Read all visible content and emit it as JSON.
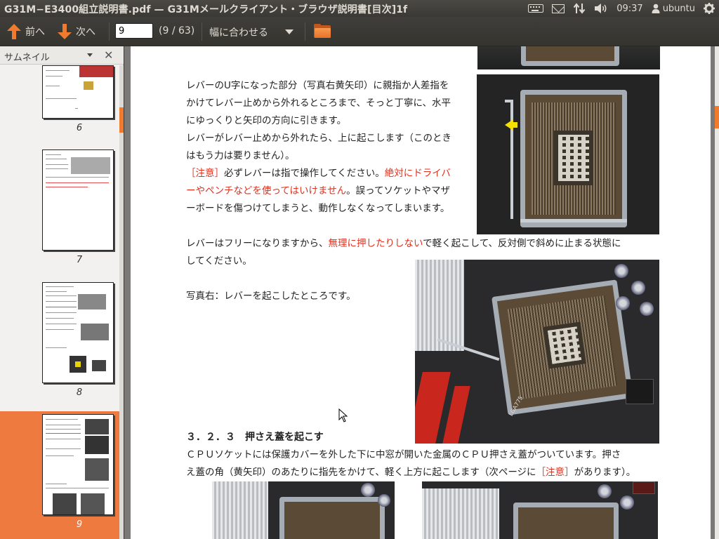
{
  "window": {
    "title": "G31M−E3400組立説明書.pdf — G31Mメールクライアント・ブラウザ説明書[目次]1f"
  },
  "panel": {
    "indicators": [
      "keyboard-icon",
      "mail-icon",
      "network-icon",
      "volume-icon"
    ],
    "clock": "09:37",
    "user": "ubuntu"
  },
  "toolbar": {
    "prev_label": "前へ",
    "next_label": "次へ",
    "page_value": "9",
    "page_count": "(9 / 63)",
    "zoom_label": "幅に合わせる"
  },
  "sidebar": {
    "title": "サムネイル",
    "thumbnails": [
      {
        "page": "6"
      },
      {
        "page": "7"
      },
      {
        "page": "8"
      },
      {
        "page": "9",
        "selected": true
      }
    ]
  },
  "document": {
    "para1": [
      "レバーのU字になった部分（写真右黄矢印）に親指か人差指を",
      "かけてレバー止めから外れるところまで、そっと丁寧に、水平",
      "にゆっくりと矢印の方向に引きます。",
      "レバーがレバー止めから外れたら、上に起こします（このとき",
      "はもう力は要りません）。"
    ],
    "caution1": {
      "tag": "［注意］",
      "plain1": "必ずレバーは指で操作してください。",
      "red1": "絶対にドライバ",
      "red2": "ーやペンチなどを使ってはいけません",
      "plain2": "。誤ってソケットやマザ",
      "line3": "ーボードを傷つけてしまうと、動作しなくなってしまいます。"
    },
    "para2": {
      "plain1": "レバーはフリーになりますから、",
      "red": "無理に押したりしない",
      "plain2": "で軽く起こして、反対側で斜めに止まる状態に",
      "line2": "してください。"
    },
    "caption": "写真右：レバーを起こしたところです。",
    "section_heading": "３．２．３　押さえ蓋を起こす",
    "para3": {
      "line1": "ＣＰＵソケットには保護カバーを外した下に中窓が開いた金属のＣＰＵ押さえ蓋がついています。押さ",
      "line2_plain1": "え蓋の角（黄矢印）のあたりに指先をかけて、軽く上方に起こします（次ページに",
      "line2_red": "［注意］",
      "line2_plain2": "があります）。"
    },
    "photo_label": "LGA775"
  },
  "colors": {
    "accent": "#f07a2e",
    "selection": "#ef7a3f",
    "caution_red": "#e0301e",
    "panel_bg": "#3c3b37"
  }
}
